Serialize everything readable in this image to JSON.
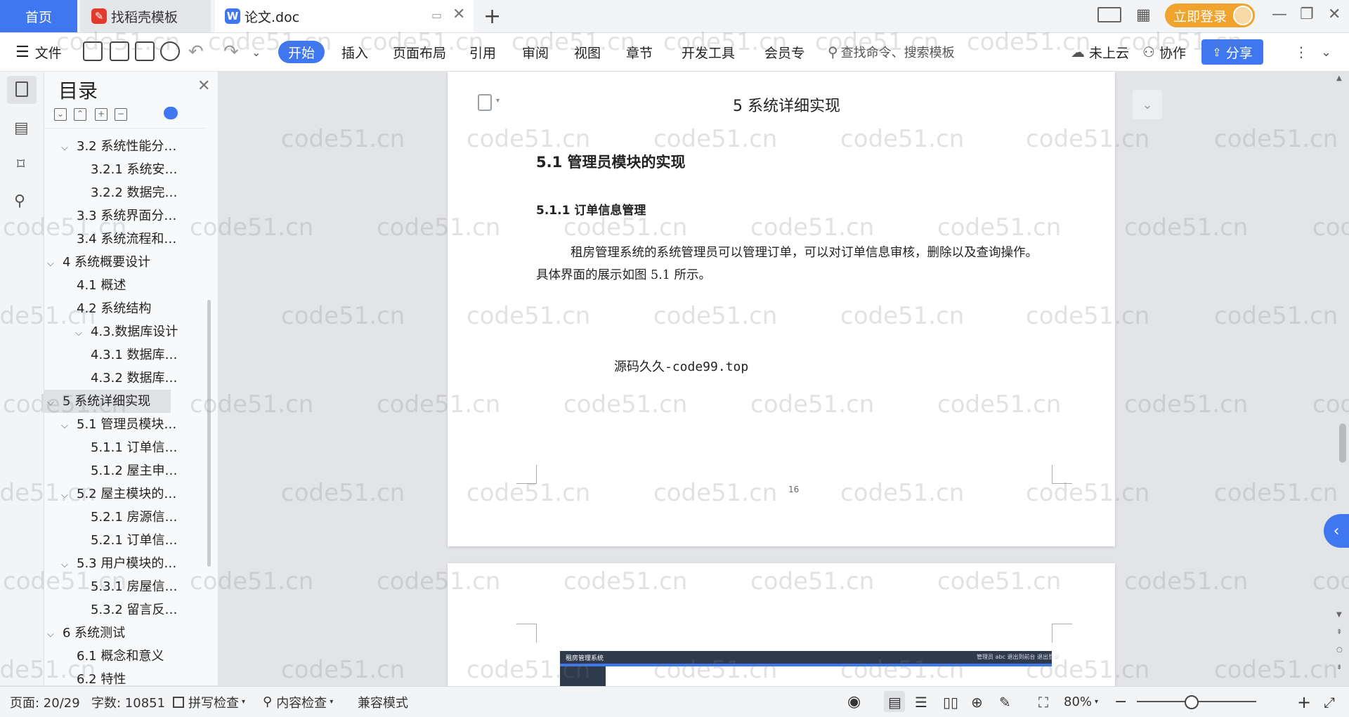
{
  "tabs": {
    "home": "首页",
    "template": "找稻壳模板",
    "document": "论文.doc",
    "new_tab": "+"
  },
  "titlebar": {
    "login": "立即登录"
  },
  "toolbar": {
    "file": "文件",
    "menus": [
      "开始",
      "插入",
      "页面布局",
      "引用",
      "审阅",
      "视图",
      "章节",
      "开发工具",
      "会员专"
    ],
    "search_placeholder": "查找命令、搜索模板",
    "cloud": "未上云",
    "collaborate": "协作",
    "share": "分享"
  },
  "toc": {
    "title": "目录",
    "items": [
      {
        "label": "3.2 系统性能分…",
        "expanded": true
      },
      {
        "label": "3.2.1 系统安…"
      },
      {
        "label": "3.2.2 数据完…"
      },
      {
        "label": "3.3 系统界面分…"
      },
      {
        "label": "3.4 系统流程和…"
      },
      {
        "label": "4 系统概要设计",
        "expanded": true
      },
      {
        "label": "4.1 概述"
      },
      {
        "label": "4.2 系统结构"
      },
      {
        "label": "4.3.数据库设计",
        "expanded": true
      },
      {
        "label": "4.3.1 数据库…"
      },
      {
        "label": "4.3.2 数据库…"
      },
      {
        "label": "5 系统详细实现",
        "expanded": true,
        "selected": true
      },
      {
        "label": "5.1 管理员模块…",
        "expanded": true
      },
      {
        "label": "5.1.1 订单信…"
      },
      {
        "label": "5.1.2 屋主申…"
      },
      {
        "label": "5.2 屋主模块的…",
        "expanded": true
      },
      {
        "label": "5.2.1 房源信…"
      },
      {
        "label": "5.2.1 订单信…"
      },
      {
        "label": "5.3 用户模块的…",
        "expanded": true
      },
      {
        "label": "5.3.1 房屋信…"
      },
      {
        "label": "5.3.2 留言反…"
      },
      {
        "label": "6 系统测试",
        "expanded": true
      },
      {
        "label": "6.1 概念和意义"
      },
      {
        "label": "6.2 特性"
      }
    ]
  },
  "document": {
    "chapter_title": "5 系统详细实现",
    "section_title": "5.1  管理员模块的实现",
    "subsection_title": "5.1.1  订单信息管理",
    "paragraph": "租房管理系统的系统管理员可以管理订单，可以对订单信息审核，删除以及查询操作。具体界面的展示如图 5.1 所示。",
    "source_note": "源码久久-code99.top",
    "page_number": "16",
    "embedded_app_title": "租房管理系统",
    "embedded_app_links": "管理员 abc    退出到前台    退出登录"
  },
  "watermark": "code51.cn",
  "statusbar": {
    "page": "页面: 20/29",
    "wordcount": "字数: 10851",
    "spellcheck": "拼写检查",
    "contentcheck": "内容检查",
    "compat": "兼容模式",
    "zoom": "80%"
  },
  "colors": {
    "accent": "#3e77f0",
    "login": "#f0a32d"
  }
}
